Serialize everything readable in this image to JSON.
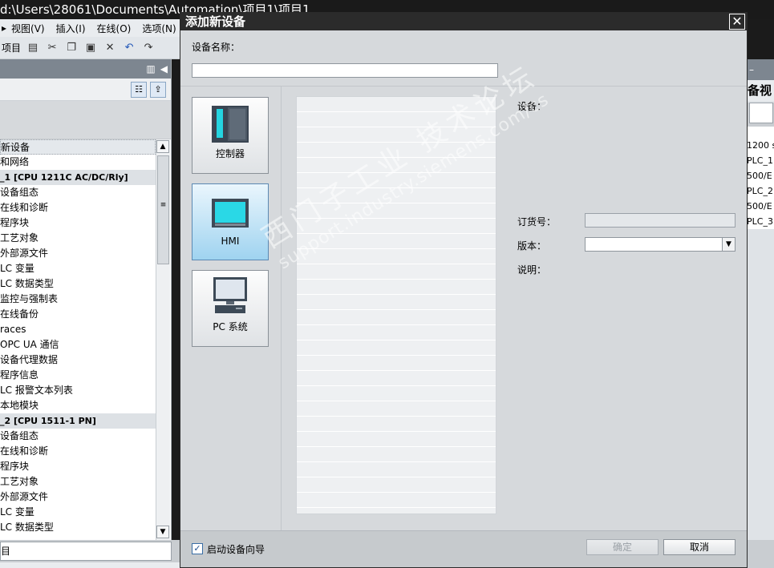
{
  "app": {
    "title": "d:\\Users\\28061\\Documents\\Automation\\项目1\\项目1",
    "menu": [
      "视图(V)",
      "插入(I)",
      "在线(O)",
      "选项(N)"
    ],
    "toolbar_project": "项目"
  },
  "tree": {
    "items": [
      {
        "label": "新设备",
        "kind": "sel"
      },
      {
        "label": "和网络",
        "kind": "item"
      },
      {
        "label": "_1 [CPU 1211C AC/DC/Rly]",
        "kind": "grp"
      },
      {
        "label": "设备组态",
        "kind": "item"
      },
      {
        "label": "在线和诊断",
        "kind": "item"
      },
      {
        "label": "程序块",
        "kind": "item"
      },
      {
        "label": "工艺对象",
        "kind": "item"
      },
      {
        "label": "外部源文件",
        "kind": "item"
      },
      {
        "label": "LC 变量",
        "kind": "item"
      },
      {
        "label": "LC 数据类型",
        "kind": "item"
      },
      {
        "label": "监控与强制表",
        "kind": "item"
      },
      {
        "label": "在线备份",
        "kind": "item"
      },
      {
        "label": "races",
        "kind": "item"
      },
      {
        "label": "OPC UA 通信",
        "kind": "item"
      },
      {
        "label": "设备代理数据",
        "kind": "item"
      },
      {
        "label": "程序信息",
        "kind": "item"
      },
      {
        "label": "LC 报警文本列表",
        "kind": "item"
      },
      {
        "label": "本地模块",
        "kind": "item"
      },
      {
        "label": "_2 [CPU 1511-1 PN]",
        "kind": "grp"
      },
      {
        "label": "设备组态",
        "kind": "item"
      },
      {
        "label": "在线和诊断",
        "kind": "item"
      },
      {
        "label": "程序块",
        "kind": "item"
      },
      {
        "label": "工艺对象",
        "kind": "item"
      },
      {
        "label": "外部源文件",
        "kind": "item"
      },
      {
        "label": "LC 变量",
        "kind": "item"
      },
      {
        "label": "LC 数据类型",
        "kind": "item"
      }
    ],
    "bottom_label": "目"
  },
  "right_panel": {
    "title": "备视",
    "items": [
      "1200 s",
      "PLC_1",
      "500/E",
      "PLC_2",
      "500/E",
      "PLC_3"
    ]
  },
  "dialog": {
    "title": "添加新设备",
    "close": "✕",
    "name_label": "设备名称：",
    "name_value": "",
    "devices": [
      {
        "label": "控制器",
        "icon": "controller-icon"
      },
      {
        "label": "HMI",
        "icon": "hmi-icon"
      },
      {
        "label": "PC 系统",
        "icon": "pc-system-icon"
      }
    ],
    "selected_device": "HMI",
    "info": {
      "device_label": "设备：",
      "order_label": "订货号：",
      "order_value": "",
      "version_label": "版本：",
      "version_value": "",
      "desc_label": "说明："
    },
    "footer": {
      "wizard_label": "启动设备向导",
      "wizard_checked": true,
      "ok_label": "确定",
      "cancel_label": "取消"
    }
  },
  "watermark": {
    "line1": "西门子工业  技术论坛",
    "line2": "support.industry.siemens.com/cs"
  }
}
